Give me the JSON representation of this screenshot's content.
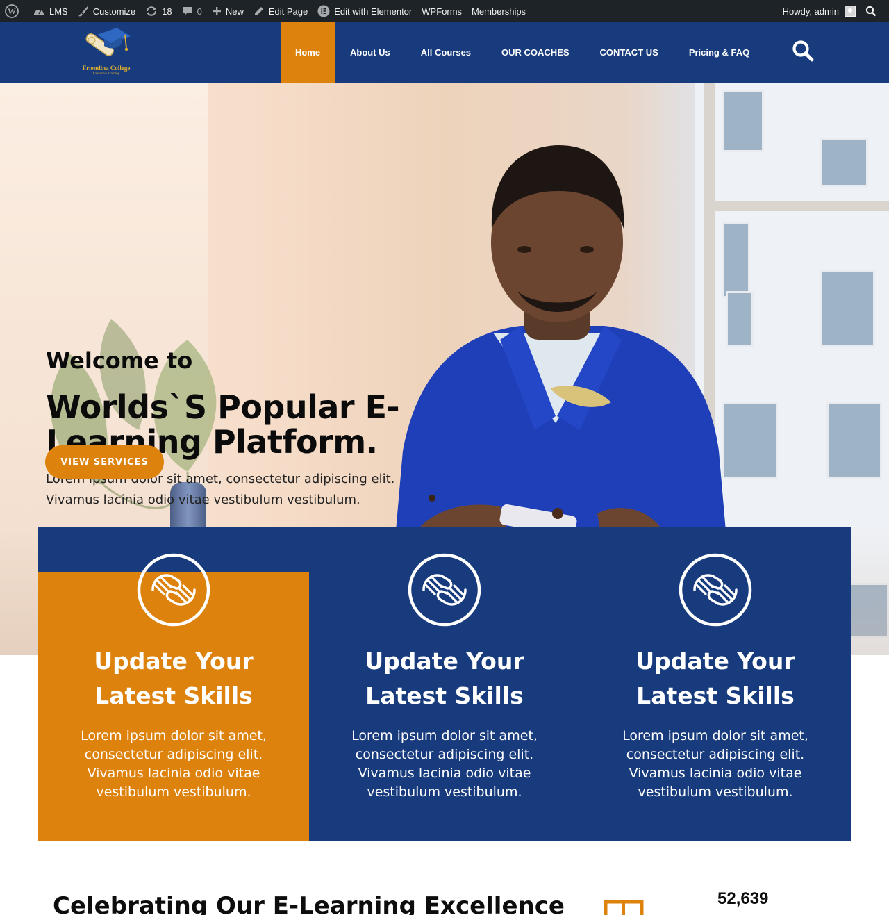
{
  "adminbar": {
    "site": "LMS",
    "customize": "Customize",
    "updates_count": "18",
    "comments_count": "0",
    "new": "New",
    "edit_page": "Edit Page",
    "elementor": "Edit with Elementor",
    "wpforms": "WPForms",
    "memberships": "Memberships",
    "howdy": "Howdy, admin"
  },
  "logo": {
    "name": "Friendina College",
    "tagline": "Executive Training"
  },
  "nav": {
    "items": [
      {
        "label": "Home",
        "active": true
      },
      {
        "label": "About Us"
      },
      {
        "label": "All Courses"
      },
      {
        "label": "OUR COACHES"
      },
      {
        "label": "CONTACT US"
      },
      {
        "label": "Pricing & FAQ"
      }
    ],
    "search_icon": "search-icon"
  },
  "hero": {
    "welcome": "Welcome to",
    "title": "Worlds`S Popular E-Learning Platform.",
    "description": "Lorem ipsum dolor sit amet, consectetur adipiscing elit. Vivamus lacinia odio vitae vestibulum vestibulum.",
    "button": "VIEW SERVICES"
  },
  "features": [
    {
      "icon": "handshake-icon",
      "title": "Update Your Latest Skills",
      "description": "Lorem ipsum dolor sit amet, consectetur adipiscing elit. Vivamus lacinia odio vitae vestibulum vestibulum."
    },
    {
      "icon": "handshake-icon",
      "title": "Update Your Latest Skills",
      "description": "Lorem ipsum dolor sit amet, consectetur adipiscing elit. Vivamus lacinia odio vitae vestibulum vestibulum."
    },
    {
      "icon": "handshake-icon",
      "title": "Update Your Latest Skills",
      "description": "Lorem ipsum dolor sit amet, consectetur adipiscing elit. Vivamus lacinia odio vitae vestibulum vestibulum."
    }
  ],
  "section": {
    "heading": "Celebrating Our E-Learning Excellence",
    "stat_number": "52,639"
  },
  "colors": {
    "brand_blue": "#173b7d",
    "accent_orange": "#dd820c",
    "adminbar": "#1d2327"
  }
}
